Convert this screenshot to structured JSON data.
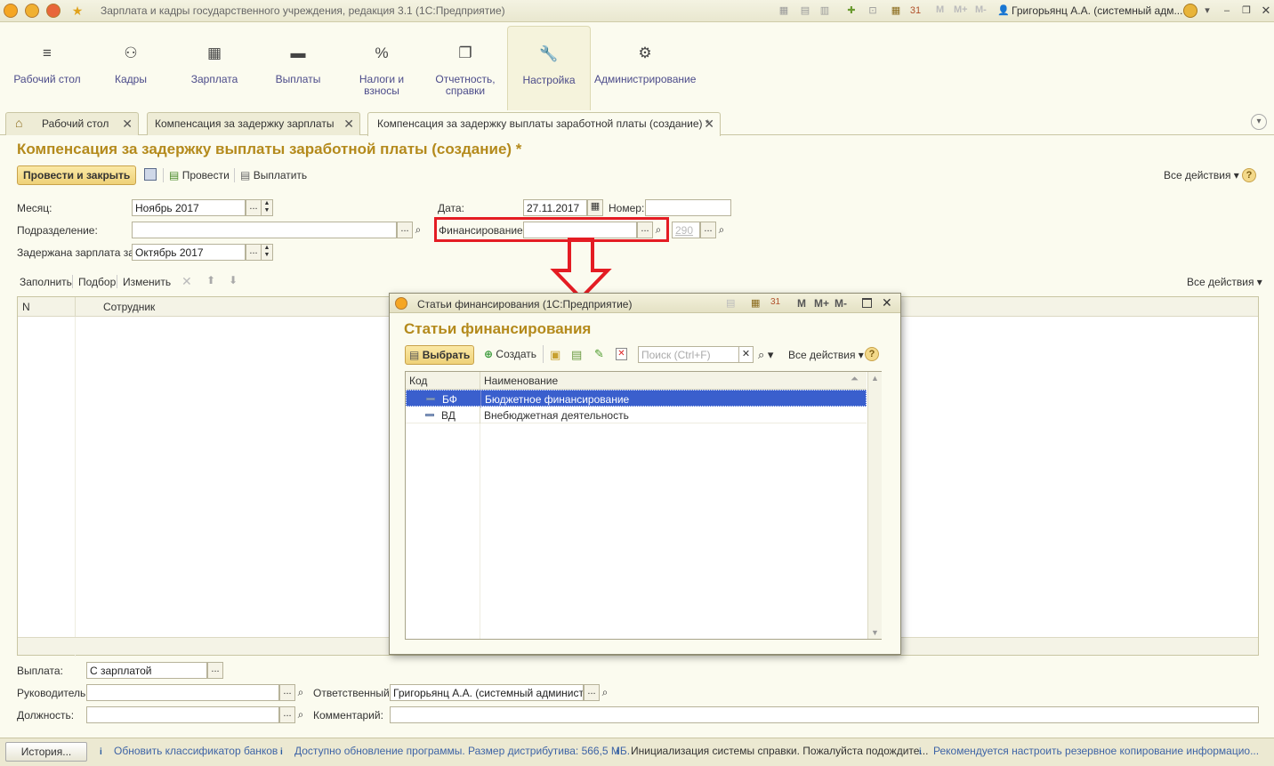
{
  "window": {
    "title": "Зарплата и кадры государственного учреждения, редакция 3.1  (1С:Предприятие)",
    "user": "Григорьянц А.А. (системный адм...",
    "mm": [
      "M",
      "M+",
      "M-"
    ]
  },
  "sections": [
    {
      "label": "Рабочий стол",
      "icon": "menu-icon"
    },
    {
      "label": "Кадры",
      "icon": "people-icon"
    },
    {
      "label": "Зарплата",
      "icon": "calculator-icon"
    },
    {
      "label": "Выплаты",
      "icon": "wallet-icon"
    },
    {
      "label": "Налоги и взносы",
      "icon": "percent-icon"
    },
    {
      "label": "Отчетность, справки",
      "icon": "document-icon"
    },
    {
      "label": "Настройка",
      "icon": "wrench-icon",
      "active": true
    },
    {
      "label": "Администрирование",
      "icon": "gear-icon"
    }
  ],
  "tabs": [
    {
      "label": "Рабочий стол"
    },
    {
      "label": "Компенсация за задержку зарплаты"
    },
    {
      "label": "Компенсация за задержку выплаты заработной платы (создание) *",
      "active": true
    }
  ],
  "form": {
    "title": "Компенсация за задержку выплаты заработной платы (создание) *",
    "btn_post_close": "Провести и закрыть",
    "btn_post": "Провести",
    "btn_pay": "Выплатить",
    "all_actions": "Все действия",
    "month_label": "Месяц:",
    "month_value": "Ноябрь 2017",
    "date_label": "Дата:",
    "date_value": "27.11.2017",
    "number_label": "Номер:",
    "number_value": "",
    "dept_label": "Подразделение:",
    "dept_value": "",
    "funding_label": "Финансирование:",
    "funding_value": "",
    "account_value": "290",
    "delayed_label": "Задержана зарплата за:",
    "delayed_value": "Октябрь 2017",
    "tb_fill": "Заполнить",
    "tb_pick": "Подбор",
    "tb_edit": "Изменить",
    "grid_all_actions": "Все действия",
    "col_n": "N",
    "col_employee": "Сотрудник",
    "payout_label": "Выплата:",
    "payout_value": "С зарплатой",
    "manager_label": "Руководитель:",
    "manager_value": "",
    "responsible_label": "Ответственный:",
    "responsible_value": "Григорьянц А.А. (системный администрат",
    "position_label": "Должность:",
    "position_value": "",
    "comment_label": "Комментарий:",
    "comment_value": ""
  },
  "dialog": {
    "window_title": "Статьи финансирования  (1С:Предприятие)",
    "heading": "Статьи финансирования",
    "btn_select": "Выбрать",
    "btn_create": "Создать",
    "search_placeholder": "Поиск (Ctrl+F)",
    "all_actions": "Все действия",
    "col_code": "Код",
    "col_name": "Наименование",
    "rows": [
      {
        "code": "БФ",
        "name": "Бюджетное финансирование",
        "selected": true
      },
      {
        "code": "ВД",
        "name": "Внебюджетная деятельность",
        "selected": false
      }
    ]
  },
  "status": {
    "history_btn": "История...",
    "messages": [
      "Обновить классификатор банков",
      "Доступно обновление программы. Размер дистрибутива: 566,5 МБ.",
      "Инициализация системы справки. Пожалуйста подождите...",
      "Рекомендуется настроить резервное копирование информацио..."
    ]
  },
  "colors": {
    "accent": "#b48a1c",
    "highlight": "#e41c23",
    "selection": "#3a5fcd"
  }
}
